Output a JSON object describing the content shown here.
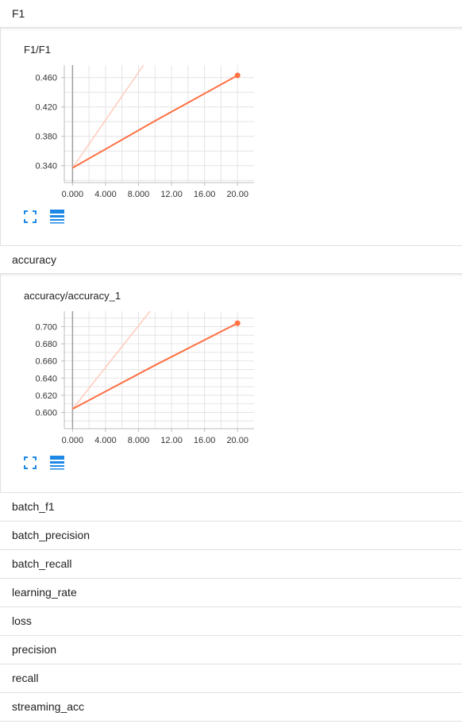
{
  "sections": [
    {
      "name": "F1",
      "chart_title": "F1/F1",
      "chart_data": {
        "type": "line",
        "title": "F1/F1",
        "x_ticks": [
          "0.000",
          "4.000",
          "8.000",
          "12.00",
          "16.00",
          "20.00"
        ],
        "y_ticks": [
          "0.340",
          "0.380",
          "0.420",
          "0.460"
        ],
        "xlim": [
          -1,
          22
        ],
        "ylim": [
          0.317,
          0.477
        ],
        "series": [
          {
            "role": "smoothed",
            "color": "#ff7043",
            "x": [
              0,
              10,
              20
            ],
            "y": [
              0.337,
              0.401,
              0.463
            ]
          },
          {
            "role": "raw",
            "color": "#ffccbc",
            "x": [
              0,
              8.6
            ],
            "y": [
              0.337,
              0.477
            ]
          }
        ]
      }
    },
    {
      "name": "accuracy",
      "chart_title": "accuracy/accuracy_1",
      "chart_data": {
        "type": "line",
        "title": "accuracy/accuracy_1",
        "x_ticks": [
          "0.000",
          "4.000",
          "8.000",
          "12.00",
          "16.00",
          "20.00"
        ],
        "y_ticks": [
          "0.600",
          "0.620",
          "0.640",
          "0.660",
          "0.680",
          "0.700"
        ],
        "xlim": [
          -1,
          22
        ],
        "ylim": [
          0.581,
          0.718
        ],
        "series": [
          {
            "role": "smoothed",
            "color": "#ff7043",
            "x": [
              0,
              10,
              20
            ],
            "y": [
              0.604,
              0.655,
              0.704
            ]
          },
          {
            "role": "raw",
            "color": "#ffccbc",
            "x": [
              0,
              9.4
            ],
            "y": [
              0.604,
              0.718
            ]
          }
        ]
      }
    }
  ],
  "tags": [
    "batch_f1",
    "batch_precision",
    "batch_recall",
    "learning_rate",
    "loss",
    "precision",
    "recall",
    "streaming_acc"
  ],
  "icons": {
    "expand": "fullscreen-icon",
    "data": "data-table-icon"
  },
  "colors": {
    "accent": "#ff7043",
    "raw": "#ffccbc",
    "icon": "#1e88e5"
  }
}
